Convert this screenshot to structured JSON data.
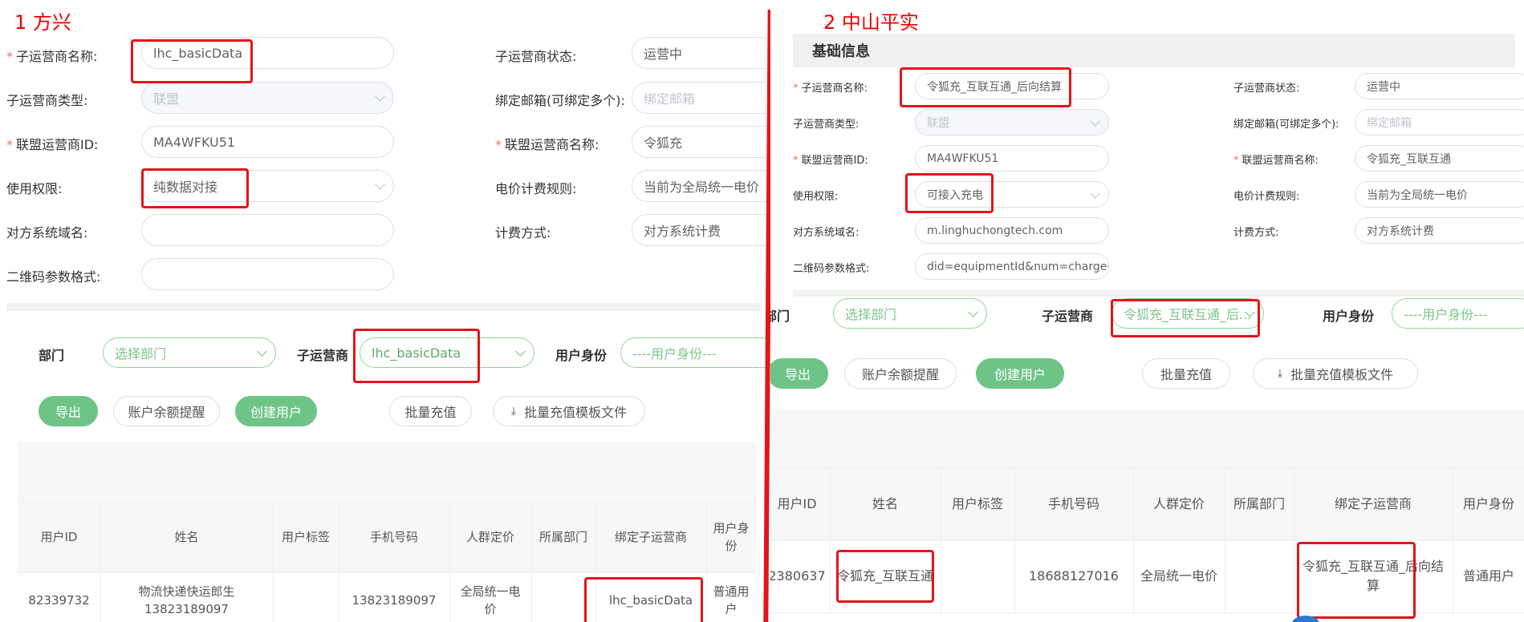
{
  "left": {
    "annotation": "1 方兴",
    "form": {
      "sub_name_label": "子运营商名称:",
      "sub_name_value": "lhc_basicData",
      "status_label": "子运营商状态:",
      "status_value": "运营中",
      "type_label": "子运营商类型:",
      "type_value": "联盟",
      "email_label": "绑定邮箱(可绑定多个):",
      "email_placeholder": "绑定邮箱",
      "alliance_id_label": "联盟运营商ID:",
      "alliance_id_value": "MA4WFKU51",
      "alliance_name_label": "联盟运营商名称:",
      "alliance_name_value": "令狐充",
      "permission_label": "使用权限:",
      "permission_value": "纯数据对接",
      "price_rule_label": "电价计费规则:",
      "price_rule_value": "当前为全局统一电价",
      "domain_label": "对方系统域名:",
      "domain_value": "",
      "billing_label": "计费方式:",
      "billing_value": "对方系统计费",
      "qr_label": "二维码参数格式:",
      "qr_value": ""
    },
    "filter": {
      "dept_label": "部门",
      "dept_placeholder": "选择部门",
      "sub_label": "子运营商",
      "sub_value": "lhc_basicData",
      "identity_label": "用户身份",
      "identity_placeholder": "----用户身份---"
    },
    "buttons": {
      "export": "导出",
      "balance_reminder": "账户余额提醒",
      "create_user": "创建用户",
      "batch_recharge": "批量充值",
      "batch_template": "批量充值模板文件"
    },
    "table": {
      "headers": [
        "用户ID",
        "姓名",
        "用户标签",
        "手机号码",
        "人群定价",
        "所属部门",
        "绑定子运营商",
        "用户身份"
      ],
      "row": [
        "82339732",
        "物流快递快运郎生 13823189097",
        "",
        "13823189097",
        "全局统一电价",
        "",
        "lhc_basicData",
        "普通用户"
      ]
    }
  },
  "right": {
    "annotation": "2 中山平实",
    "section_title": "基础信息",
    "form": {
      "sub_name_label": "子运营商名称:",
      "sub_name_value": "令狐充_互联互通_后向结算",
      "status_label": "子运营商状态:",
      "status_value": "运营中",
      "type_label": "子运营商类型:",
      "type_value": "联盟",
      "email_label": "绑定邮箱(可绑定多个):",
      "email_placeholder": "绑定邮箱",
      "alliance_id_label": "联盟运营商ID:",
      "alliance_id_value": "MA4WFKU51",
      "alliance_name_label": "联盟运营商名称:",
      "alliance_name_value": "令狐充_互联互通",
      "permission_label": "使用权限:",
      "permission_value": "可接入充电",
      "price_rule_label": "电价计费规则:",
      "price_rule_value": "当前为全局统一电价",
      "domain_label": "对方系统域名:",
      "domain_value": "m.linghuchongtech.com",
      "billing_label": "计费方式:",
      "billing_value": "对方系统计费",
      "qr_label": "二维码参数格式:",
      "qr_value": "did=equipmentId&num=chargeUnitI"
    },
    "filter": {
      "dept_label": "部门",
      "dept_placeholder": "选择部门",
      "sub_label": "子运营商",
      "sub_value": "令狐充_互联互通_后...",
      "identity_label": "用户身份",
      "identity_placeholder": "----用户身份---"
    },
    "buttons": {
      "export": "导出",
      "balance_reminder": "账户余额提醒",
      "create_user": "创建用户",
      "batch_recharge": "批量充值",
      "batch_template": "批量充值模板文件"
    },
    "table": {
      "headers": [
        "用户ID",
        "姓名",
        "用户标签",
        "手机号码",
        "人群定价",
        "所属部门",
        "绑定子运营商",
        "用户身份"
      ],
      "row": [
        "2380637",
        "令狐充_互联互通",
        "",
        "18688127016",
        "全局统一电价",
        "",
        "令狐充_互联互通_后向结算",
        "普通用户"
      ]
    }
  },
  "colors": {
    "annotation": "#e4141b",
    "accent_green": "#6ec486",
    "required": "#f56c6c"
  },
  "icons": [
    "chevron-down-icon",
    "download-icon"
  ]
}
